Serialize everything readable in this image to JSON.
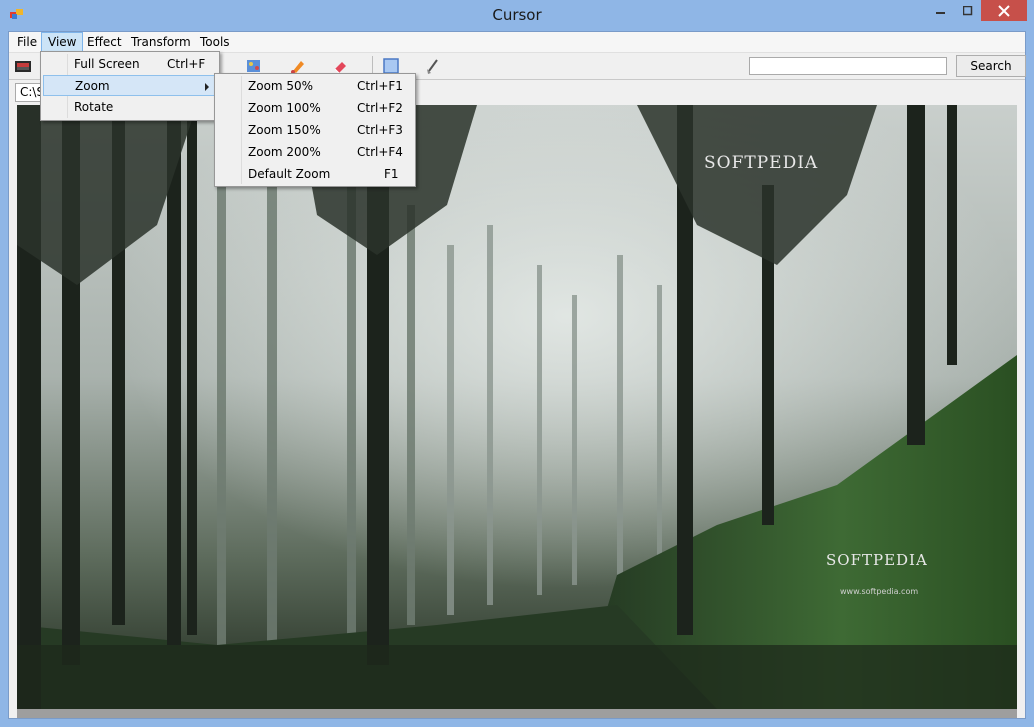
{
  "window": {
    "title": "Cursor"
  },
  "menubar": {
    "items": [
      "File",
      "View",
      "Effect",
      "Transform",
      "Tools"
    ],
    "active": "View"
  },
  "toolbar": {
    "icons": [
      "photo-icon",
      "palette-icon",
      "paint-icon",
      "eraser-icon",
      "select-rect-icon",
      "brush-icon"
    ],
    "search_value": "",
    "search_label": "Search"
  },
  "path": {
    "value": "C:\\S"
  },
  "view_menu": {
    "items": [
      {
        "label": "Full Screen",
        "shortcut": "Ctrl+F"
      },
      {
        "label": "Zoom",
        "shortcut": ""
      },
      {
        "label": "Rotate",
        "shortcut": ""
      }
    ]
  },
  "zoom_menu": {
    "items": [
      {
        "label": "Zoom 50%",
        "shortcut": "Ctrl+F1"
      },
      {
        "label": "Zoom 100%",
        "shortcut": "Ctrl+F2"
      },
      {
        "label": "Zoom 150%",
        "shortcut": "Ctrl+F3"
      },
      {
        "label": "Zoom 200%",
        "shortcut": "Ctrl+F4"
      },
      {
        "label": "Default Zoom",
        "shortcut": "F1"
      }
    ]
  },
  "image": {
    "watermark_top": "SOFTPEDIA",
    "watermark_bottom": "SOFTPEDIA",
    "watermark_url": "www.softpedia.com"
  },
  "colors": {
    "close_button": "#c7504a",
    "menu_highlight": "#d5e6f7",
    "title_bar": "#8fb6e6"
  }
}
